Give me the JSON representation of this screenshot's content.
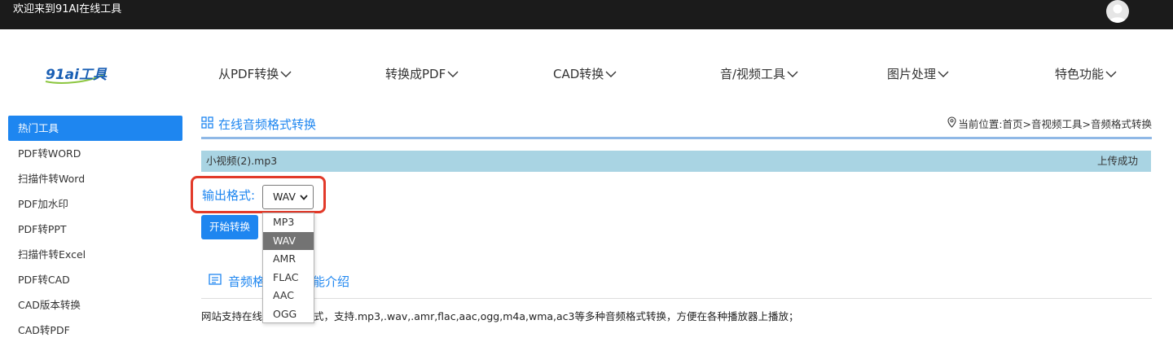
{
  "topbar": {
    "welcome": "欢迎来到91AI在线工具"
  },
  "logo": {
    "text": "91ai工具"
  },
  "nav": {
    "items": [
      {
        "label": "从PDF转换"
      },
      {
        "label": "转换成PDF"
      },
      {
        "label": "CAD转换"
      },
      {
        "label": "音/视频工具"
      },
      {
        "label": "图片处理"
      },
      {
        "label": "特色功能"
      }
    ]
  },
  "sidebar": {
    "items": [
      {
        "label": "热门工具"
      },
      {
        "label": "PDF转WORD"
      },
      {
        "label": "扫描件转Word"
      },
      {
        "label": "PDF加水印"
      },
      {
        "label": "PDF转PPT"
      },
      {
        "label": "扫描件转Excel"
      },
      {
        "label": "PDF转CAD"
      },
      {
        "label": "CAD版本转换"
      },
      {
        "label": "CAD转PDF"
      }
    ]
  },
  "panel": {
    "title": "在线音频格式转换",
    "breadcrumb": "当前位置:首页>音视频工具>音频格式转换"
  },
  "file": {
    "name": "小视频(2).mp3",
    "status": "上传成功"
  },
  "format": {
    "label": "输出格式:",
    "selected": "WAV",
    "options": [
      "MP3",
      "WAV",
      "AMR",
      "FLAC",
      "AAC",
      "OGG"
    ]
  },
  "start_button": "开始转换",
  "intro": {
    "title_start": "音频格",
    "title_end": "功能介绍",
    "desc_start": "网站支持在线",
    "desc_end": "式，支持.mp3,.wav,.amr,flac,aac,ogg,m4a,wma,ac3等多种音频格式转换，方便在各种播放器上播放；"
  },
  "colors": {
    "accent": "#1e86f0",
    "topbar": "#1b1b1b",
    "file_row": "#a9d4e3",
    "highlight": "#e23a2a"
  }
}
